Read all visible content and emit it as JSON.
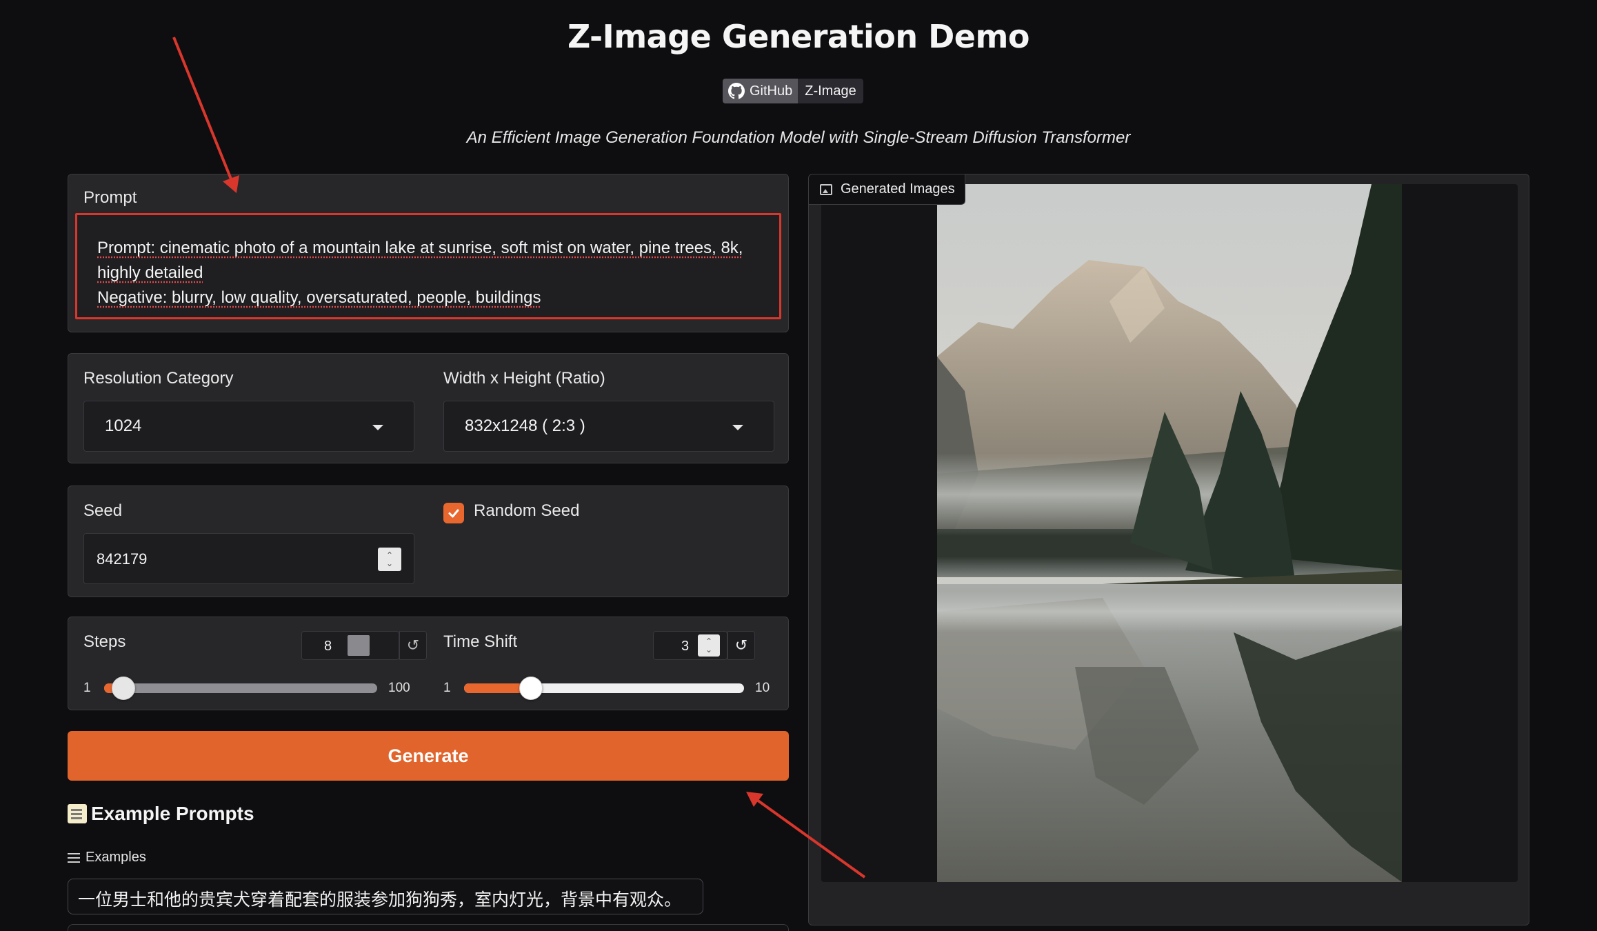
{
  "header": {
    "title": "Z-Image Generation Demo",
    "badge_left": "GitHub",
    "badge_right": "Z-Image",
    "subtitle": "An Efficient Image Generation Foundation Model with Single-Stream Diffusion Transformer"
  },
  "prompt": {
    "label": "Prompt",
    "line1": "Prompt: cinematic photo of a mountain lake at sunrise, soft mist on water, pine trees, 8k,",
    "line2": "highly detailed",
    "line3": "Negative: blurry, low quality, oversaturated, people, buildings"
  },
  "resolution": {
    "category_label": "Resolution Category",
    "category_value": "1024",
    "size_label": "Width x Height (Ratio)",
    "size_value": "832x1248 ( 2:3 )"
  },
  "seed": {
    "label": "Seed",
    "value": "842179",
    "random_label": "Random Seed",
    "random_checked": true
  },
  "steps": {
    "label": "Steps",
    "value": "8",
    "min": "1",
    "max": "100",
    "fraction": 0.07
  },
  "time_shift": {
    "label": "Time Shift",
    "value": "3",
    "min": "1",
    "max": "10",
    "fraction": 0.24
  },
  "generate_label": "Generate",
  "examples": {
    "heading": "Example Prompts",
    "label": "Examples",
    "items": [
      "一位男士和他的贵宾犬穿着配套的服装参加狗狗秀，室内灯光，背景中有观众。"
    ]
  },
  "gallery": {
    "tab_label": "Generated Images"
  },
  "colors": {
    "accent": "#e0642b",
    "annotation_red": "#d9362c",
    "background": "#0e0e11",
    "panel": "#27272a"
  },
  "icons": [
    "github-icon",
    "chevron-down-icon",
    "checkmark-icon",
    "reset-icon",
    "memo-icon",
    "list-icon",
    "image-icon"
  ]
}
